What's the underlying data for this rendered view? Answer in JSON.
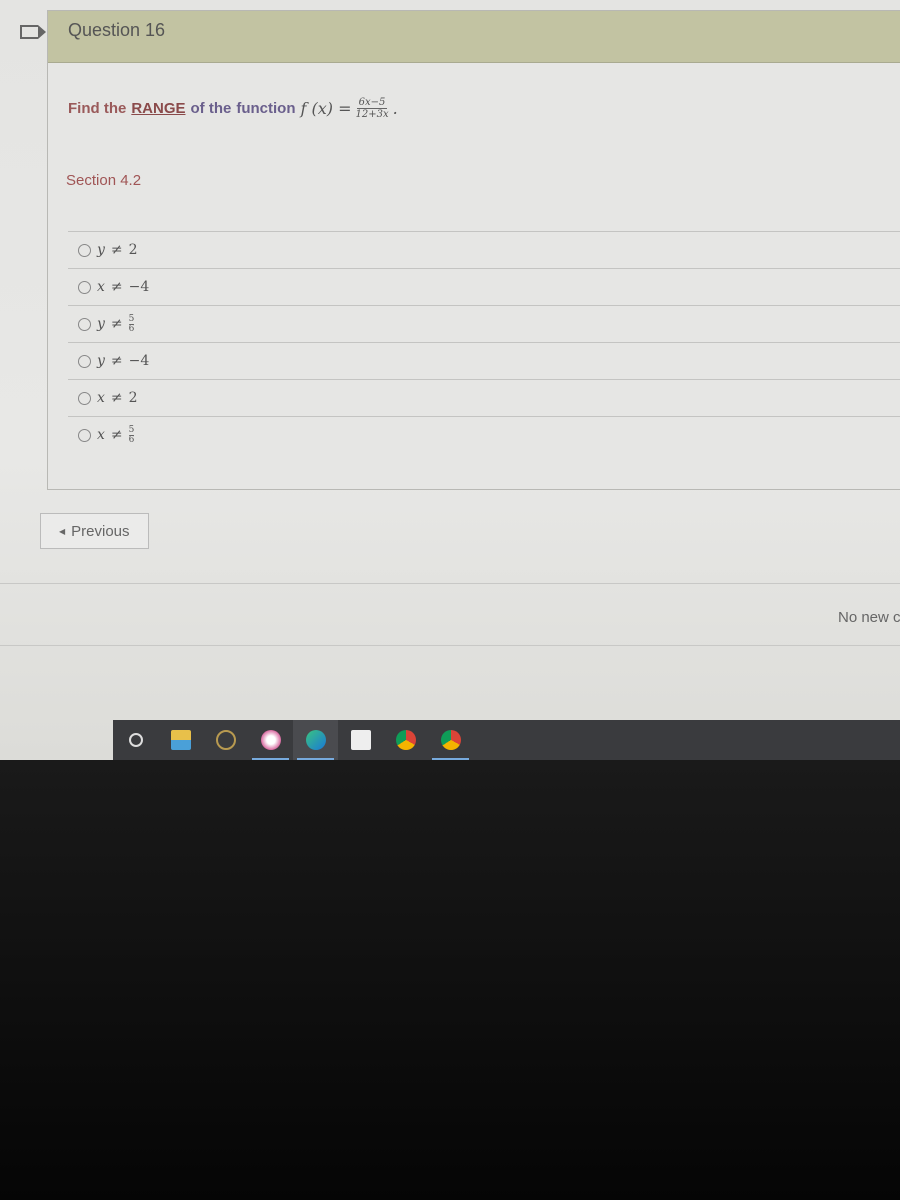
{
  "question": {
    "title": "Question 16",
    "prompt_parts": {
      "find": "Find the",
      "range": "RANGE",
      "of": "of the",
      "function": "function"
    },
    "function_lhs": "f (x) =",
    "numerator": "6x−5",
    "denominator": "12+3x",
    "period": ".",
    "section": "Section 4.2"
  },
  "options": [
    {
      "var": "y",
      "rel": "≠",
      "value": "2"
    },
    {
      "var": "x",
      "rel": "≠",
      "value": "−4"
    },
    {
      "var": "y",
      "rel": "≠",
      "num": "5",
      "den": "6"
    },
    {
      "var": "y",
      "rel": "≠",
      "value": "−4"
    },
    {
      "var": "x",
      "rel": "≠",
      "value": "2"
    },
    {
      "var": "x",
      "rel": "≠",
      "num": "5",
      "den": "6"
    }
  ],
  "nav": {
    "previous_label": "Previous"
  },
  "notifications": {
    "text": "No new c"
  },
  "taskbar": {
    "icons": [
      "search-circle-icon",
      "file-explorer-icon",
      "league-of-legends-icon",
      "itunes-icon",
      "edge-icon",
      "microsoft-store-icon",
      "chrome-icon",
      "chrome-profile-icon"
    ],
    "colors": {
      "bar": "#3a3b3e",
      "underline": "#77aadd"
    }
  }
}
